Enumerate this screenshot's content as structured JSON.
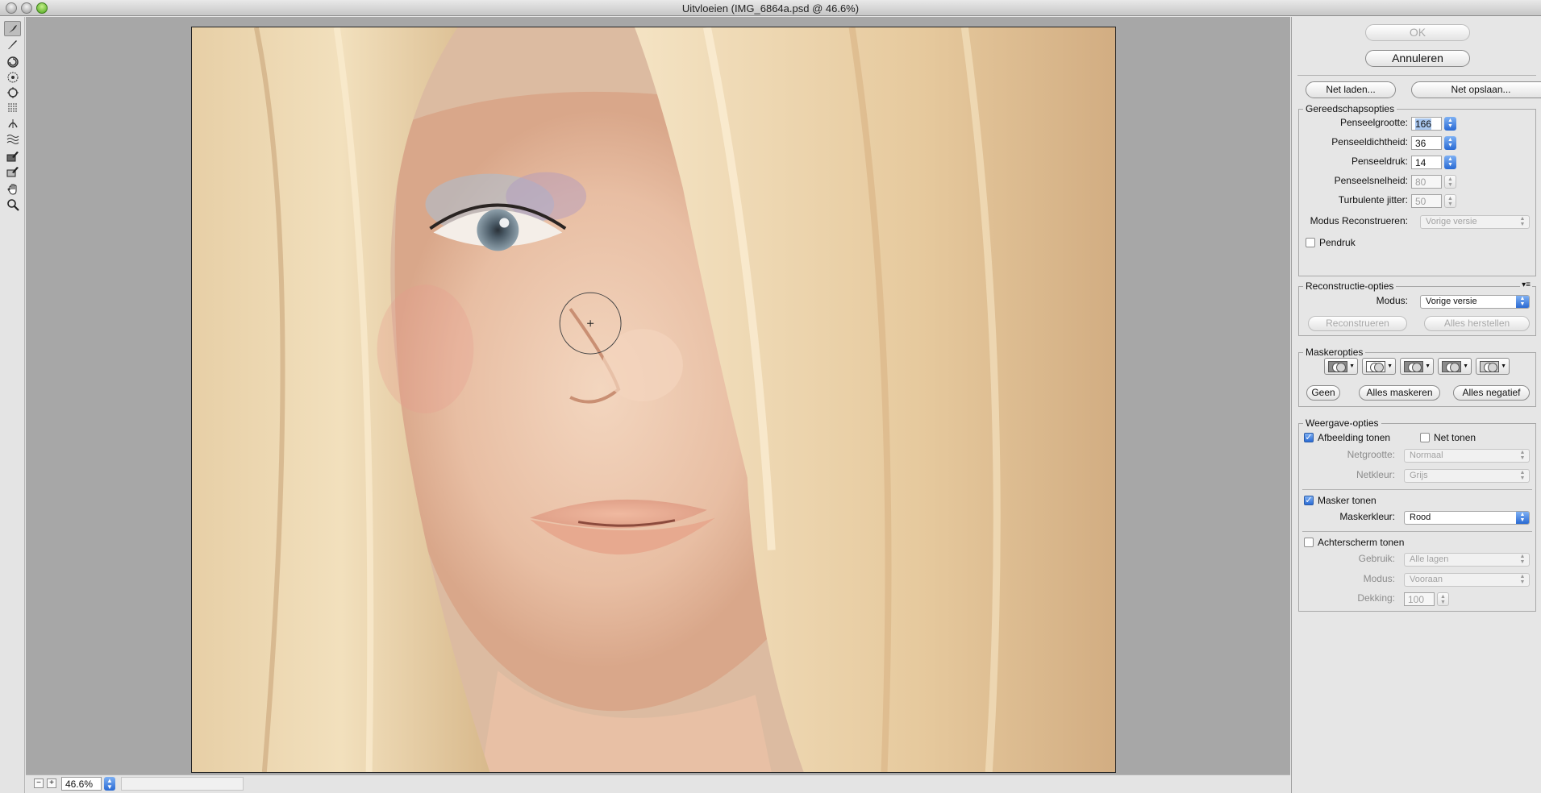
{
  "window": {
    "title": "Uitvloeien (IMG_6864a.psd @ 46.6%)"
  },
  "tools": [
    {
      "name": "forward-warp-tool-icon"
    },
    {
      "name": "reconstruct-tool-icon"
    },
    {
      "name": "twirl-clockwise-tool-icon"
    },
    {
      "name": "pucker-tool-icon"
    },
    {
      "name": "bloat-tool-icon"
    },
    {
      "name": "push-left-tool-icon"
    },
    {
      "name": "mirror-tool-icon"
    },
    {
      "name": "turbulence-tool-icon"
    },
    {
      "name": "freeze-mask-tool-icon"
    },
    {
      "name": "thaw-mask-tool-icon"
    },
    {
      "name": "hand-tool-icon"
    },
    {
      "name": "zoom-tool-icon"
    }
  ],
  "status": {
    "zoom": "46.6%",
    "zoom_minus": "−",
    "zoom_plus": "+"
  },
  "buttons": {
    "ok": "OK",
    "cancel": "Annuleren",
    "load_mesh": "Net laden...",
    "save_mesh": "Net opslaan..."
  },
  "tool_options": {
    "title": "Gereedschapsopties",
    "brush_size_label": "Penseelgrootte:",
    "brush_size": "166",
    "brush_density_label": "Penseeldichtheid:",
    "brush_density": "36",
    "brush_pressure_label": "Penseeldruk:",
    "brush_pressure": "14",
    "brush_rate_label": "Penseelsnelheid:",
    "brush_rate": "80",
    "turbulent_jitter_label": "Turbulente jitter:",
    "turbulent_jitter": "50",
    "reconstruct_mode_label": "Modus Reconstrueren:",
    "reconstruct_mode": "Vorige versie",
    "stylus_pressure_label": "Pendruk",
    "stylus_pressure_checked": false
  },
  "reconstruct_options": {
    "title": "Reconstructie-opties",
    "mode_label": "Modus:",
    "mode": "Vorige versie",
    "reconstruct_button": "Reconstrueren",
    "restore_all_button": "Alles herstellen"
  },
  "mask_options": {
    "title": "Maskeropties",
    "none_button": "Geen",
    "mask_all_button": "Alles maskeren",
    "invert_all_button": "Alles negatief"
  },
  "view_options": {
    "title": "Weergave-opties",
    "show_image_label": "Afbeelding tonen",
    "show_image_checked": true,
    "show_mesh_label": "Net tonen",
    "show_mesh_checked": false,
    "mesh_size_label": "Netgrootte:",
    "mesh_size": "Normaal",
    "mesh_color_label": "Netkleur:",
    "mesh_color": "Grijs",
    "show_mask_label": "Masker tonen",
    "show_mask_checked": true,
    "mask_color_label": "Maskerkleur:",
    "mask_color": "Rood",
    "show_backdrop_label": "Achterscherm tonen",
    "show_backdrop_checked": false,
    "use_label": "Gebruik:",
    "use": "Alle lagen",
    "mode_label": "Modus:",
    "mode": "Vooraan",
    "opacity_label": "Dekking:",
    "opacity": "100"
  },
  "colors": {
    "accent": "#2a6ad3",
    "canvas_bg": "#a7a7a7",
    "panel_bg": "#e6e6e6"
  }
}
